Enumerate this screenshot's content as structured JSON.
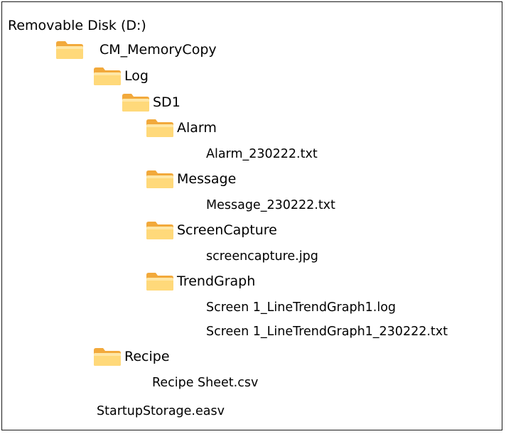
{
  "tree": {
    "root": {
      "label": "Removable Disk (D:)"
    },
    "cm_memorycopy": {
      "label": "CM_MemoryCopy",
      "icon": "folder-icon"
    },
    "log": {
      "label": "Log",
      "icon": "folder-icon"
    },
    "sd1": {
      "label": "SD1",
      "icon": "folder-icon"
    },
    "alarm": {
      "label": "Alarm",
      "icon": "folder-icon",
      "files": [
        "Alarm_230222.txt"
      ]
    },
    "message": {
      "label": "Message",
      "icon": "folder-icon",
      "files": [
        "Message_230222.txt"
      ]
    },
    "screencapture": {
      "label": "ScreenCapture",
      "icon": "folder-icon",
      "files": [
        "screencapture.jpg"
      ]
    },
    "trendgraph": {
      "label": "TrendGraph",
      "icon": "folder-icon",
      "files": [
        "Screen 1_LineTrendGraph1.log",
        "Screen 1_LineTrendGraph1_230222.txt"
      ]
    },
    "recipe": {
      "label": "Recipe",
      "icon": "folder-icon",
      "files": [
        "Recipe Sheet.csv"
      ]
    },
    "root_files": [
      "StartupStorage.easv"
    ]
  },
  "colors": {
    "folder_light": "#FFD97A",
    "folder_dark": "#F2A93B",
    "border": "#1A1A1A"
  }
}
